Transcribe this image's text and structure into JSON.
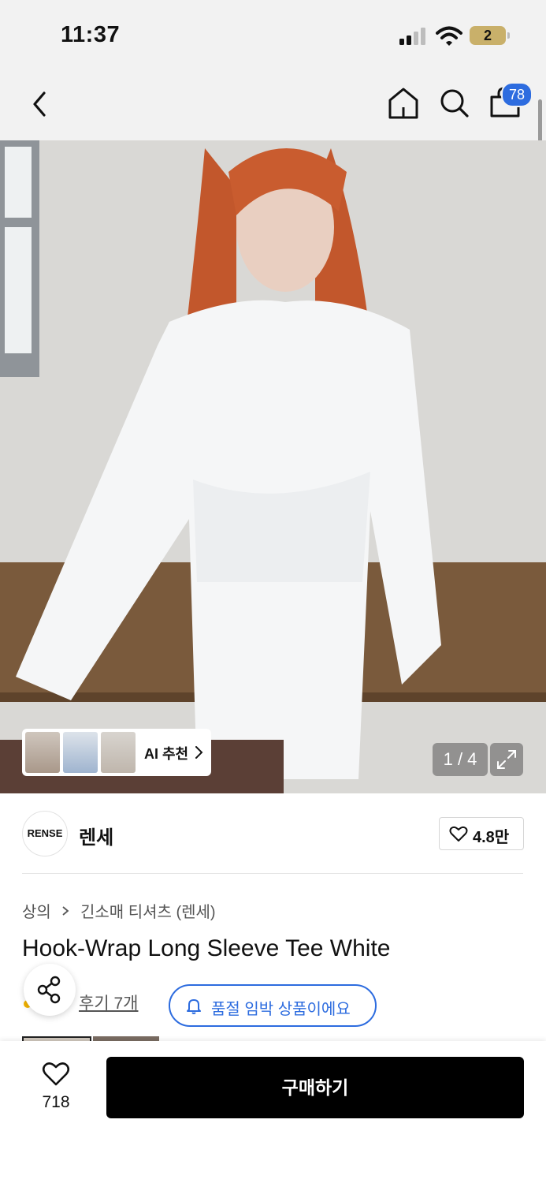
{
  "status_bar": {
    "time": "11:37",
    "battery": "2"
  },
  "nav": {
    "cart_badge": "78"
  },
  "gallery": {
    "ai_recommend_label": "AI 추천",
    "counter": "1 / 4"
  },
  "brand": {
    "logo_text": "RENSE",
    "name": "렌세",
    "likes": "4.8만"
  },
  "breadcrumb": {
    "category": "상의",
    "subcategory": "긴소매 티셔츠 (렌세)"
  },
  "product": {
    "title": "Hook-Wrap Long Sleeve Tee White"
  },
  "reviews": {
    "label": "후기 7개"
  },
  "notice": {
    "soldout_text": "품절 임박 상품이에요"
  },
  "bottom_bar": {
    "wish_count": "718",
    "buy_label": "구매하기"
  },
  "colors": {
    "accent": "#2d6cdf",
    "buy_button": "#000000",
    "header_bg": "#f2f2f2"
  },
  "icons": [
    "back-arrow-icon",
    "home-icon",
    "search-icon",
    "shopping-bag-icon",
    "chevron-right-icon",
    "expand-icon",
    "heart-icon",
    "share-icon",
    "bell-icon"
  ]
}
